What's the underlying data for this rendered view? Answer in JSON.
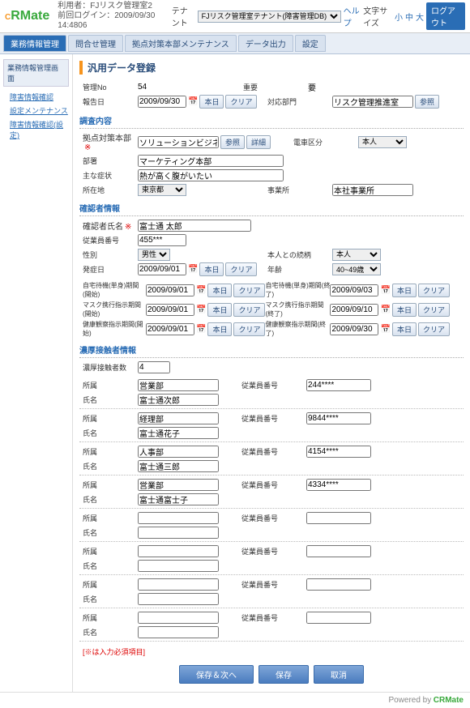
{
  "header": {
    "user": "利用者：FJリスク管理室2",
    "login": "前回ログイン：2009/09/30 14:4806",
    "tenant_lbl": "テナント",
    "tenant_val": "FJリスク管理室テナント(障害管理DB)",
    "help": "ヘルプ",
    "size_lbl": "文字サイズ",
    "size_s": "小",
    "size_m": "中",
    "size_l": "大",
    "logout": "ログアウト"
  },
  "tabs": [
    "業務情報管理",
    "問合せ管理",
    "拠点対策本部メンテナンス",
    "データ出力",
    "設定"
  ],
  "side": {
    "h": "業務情報管理画面",
    "i1": "障害情報確認",
    "i2": "設定メンテナンス",
    "i3": "障害情報確認(設定)"
  },
  "title": "汎用データ登録",
  "s1": {
    "mgmt_lbl": "管理No",
    "mgmt": "54",
    "hodo_lbl": "報告日",
    "hodo": "2009/09/30",
    "jubun_lbl": "重要",
    "jubun": "要",
    "taio_lbl": "対応部門",
    "taio": "リスク管理推進室"
  },
  "s2": {
    "h": "調査内容",
    "kyoten_lbl": "拠点対策本部",
    "kyoten": "ソリューションビジネスサポー",
    "busho_lbl": "部署",
    "busho": "マーケティング本部",
    "shuyo_lbl": "主な症状",
    "shuyo": "熱が高く腹がいたい",
    "area_lbl": "所在地",
    "area": "東京都",
    "jigyosho_lbl": "事業所",
    "jigyosho": "本社事業所",
    "denku_lbl": "電車区分",
    "denku": "本人"
  },
  "s3": {
    "h": "確認者情報",
    "name_lbl": "確認者氏名",
    "name": "富士通 太郎",
    "jno_lbl": "従業員番号",
    "jno": "455***",
    "sex_lbl": "性別",
    "sex": "男性",
    "hassei_lbl": "発症日",
    "hassei": "2009/09/01",
    "rel_lbl": "本人との続柄",
    "rel": "本人",
    "age_lbl": "年齢",
    "age": "40~49歳"
  },
  "s4": {
    "l1": "自宅待機(単身)期間(開始)",
    "l2": "マスク携行指示期間(開始)",
    "l3": "健康観察指示期間(開始)",
    "r1": "自宅待機(単身)期間(終了)",
    "r2": "マスク携行指示期間(終了)",
    "r3": "健康観察指示期間(終了)",
    "d1": "2009/09/01",
    "d2": "2009/09/01",
    "d3": "2009/09/01",
    "e1": "2009/09/03",
    "e2": "2009/09/10",
    "e3": "2009/09/30"
  },
  "s5": {
    "h": "濃厚接触者情報",
    "cnt_lbl": "濃厚接触者数",
    "cnt": "4"
  },
  "rows": [
    {
      "sh": "営業部",
      "nm": "富士通次郎",
      "no": "244****"
    },
    {
      "sh": "経理部",
      "nm": "富士通花子",
      "no": "9844****"
    },
    {
      "sh": "人事部",
      "nm": "富士通三郎",
      "no": "4154****"
    },
    {
      "sh": "営業部",
      "nm": "富士通富士子",
      "no": "4334****"
    },
    {
      "sh": "",
      "nm": "",
      "no": ""
    },
    {
      "sh": "",
      "nm": "",
      "no": ""
    },
    {
      "sh": "",
      "nm": "",
      "no": ""
    },
    {
      "sh": "",
      "nm": "",
      "no": ""
    }
  ],
  "lbl": {
    "shozoku": "所属",
    "shimei": "氏名",
    "jno": "従業員番号"
  },
  "btn": {
    "today": "本日",
    "clear": "クリア",
    "ref": "参照",
    "detail": "詳細",
    "save_next": "保存＆次へ",
    "save": "保存",
    "cancel": "取消"
  },
  "note": "[※は入力必須項目]",
  "foot": "Powered by",
  "brand": "CRMate"
}
